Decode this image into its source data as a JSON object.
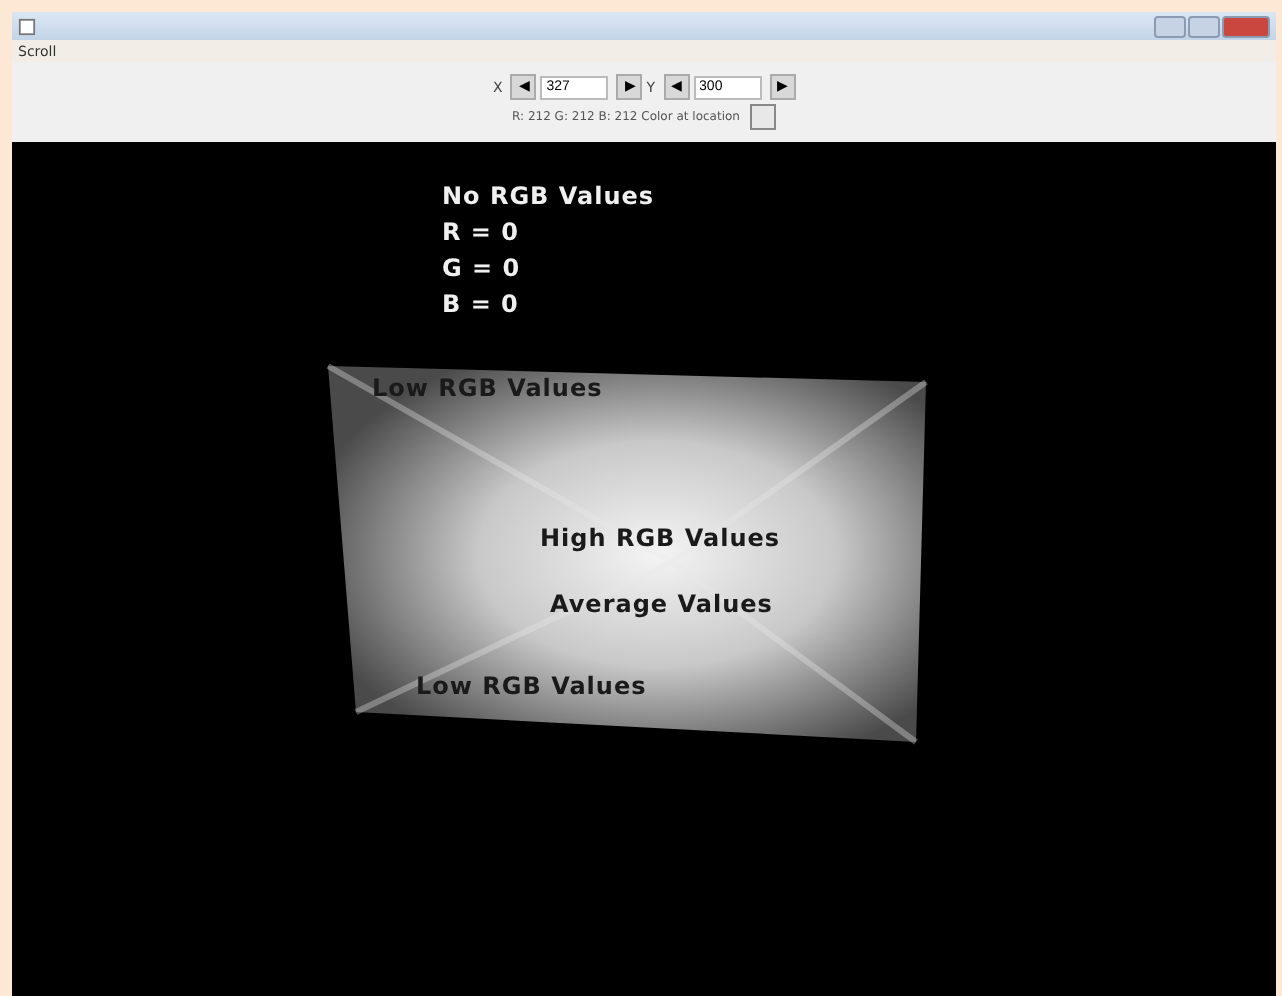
{
  "menu": [
    {
      "label": "Scroll"
    }
  ],
  "controls": {
    "x_label": "X",
    "x_value": "327",
    "y_label": "Y",
    "y_value": "300",
    "prev": "◀",
    "next": "▶"
  },
  "status": {
    "text": "R: 212 G: 212 B: 212 Color at location"
  },
  "canvas": {
    "labels": [
      {
        "kind": "light",
        "text": "No RGB Values"
      },
      {
        "kind": "light",
        "text": "R = 0"
      },
      {
        "kind": "light",
        "text": "G = 0"
      },
      {
        "kind": "light",
        "text": "B = 0"
      },
      {
        "kind": "dark",
        "text": "Low RGB Values"
      },
      {
        "kind": "dark",
        "text": "High RGB Values"
      },
      {
        "kind": "dark",
        "text": "Average Values"
      },
      {
        "kind": "dark",
        "text": "Low RGB Values"
      }
    ]
  }
}
